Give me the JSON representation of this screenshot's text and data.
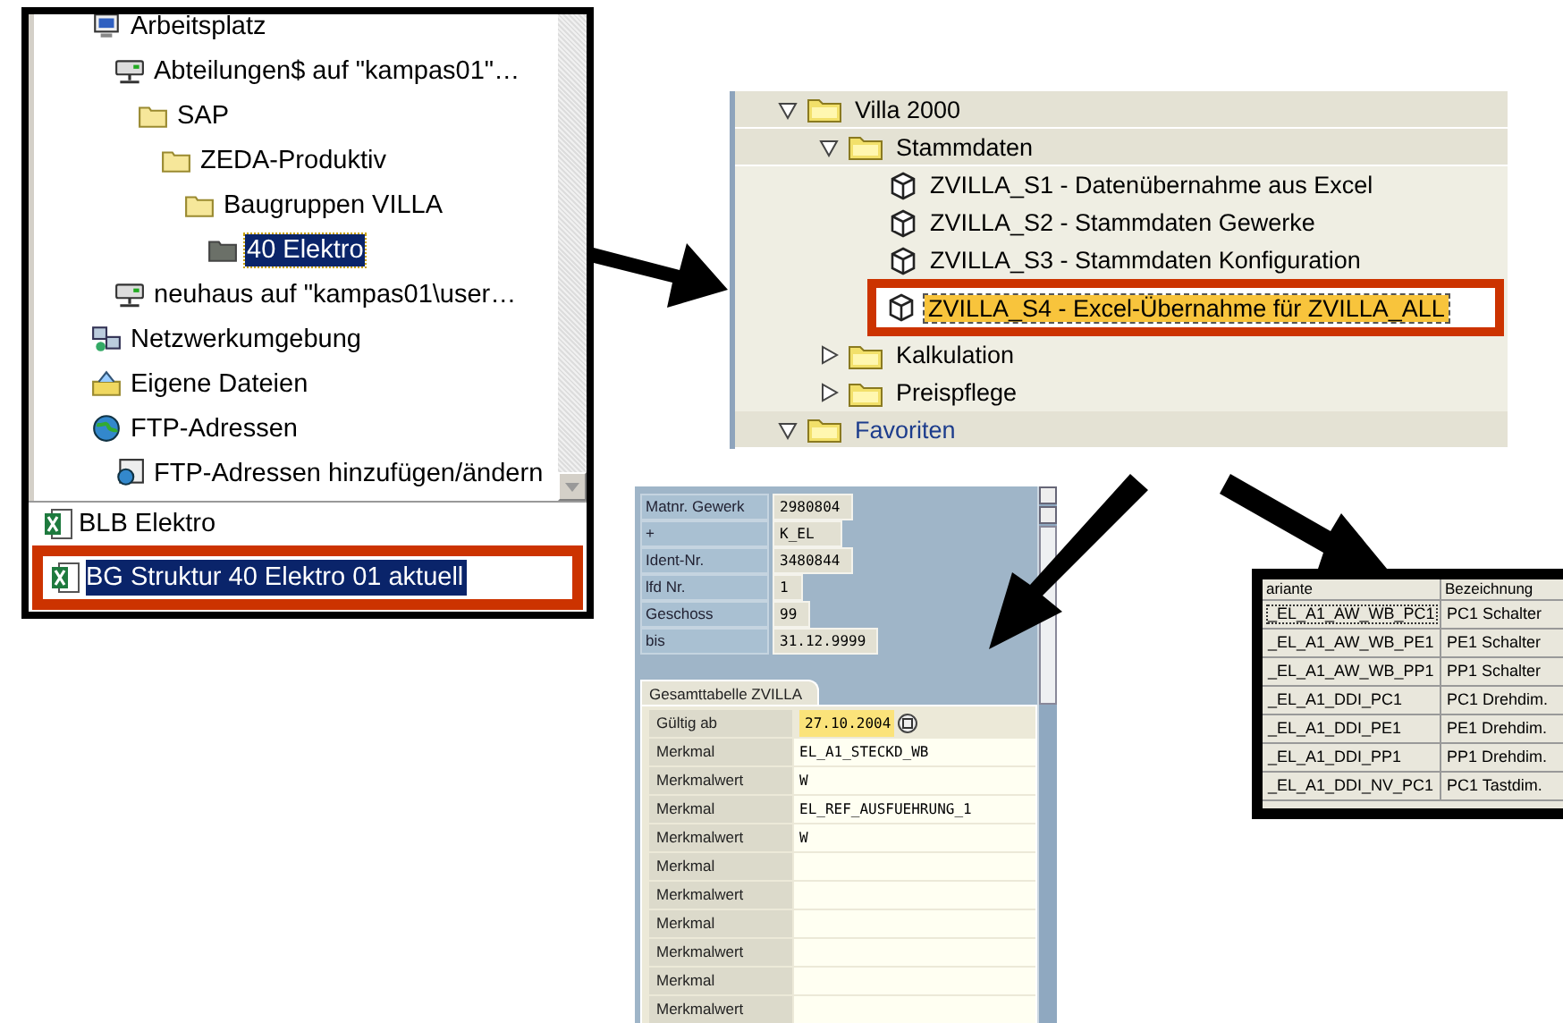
{
  "explorer": {
    "tree": [
      {
        "label": "Arbeitsplatz",
        "kind": "computer",
        "selected": false,
        "children": [
          {
            "label": "Abteilungen$ auf \"kampas01\"…",
            "kind": "drive",
            "selected": false,
            "children": [
              {
                "label": "SAP",
                "kind": "folder",
                "selected": false,
                "children": [
                  {
                    "label": "ZEDA-Produktiv",
                    "kind": "folder",
                    "selected": false,
                    "children": [
                      {
                        "label": "Baugruppen VILLA",
                        "kind": "folder",
                        "selected": false,
                        "children": [
                          {
                            "label": "40 Elektro",
                            "kind": "folder",
                            "selected": true
                          }
                        ]
                      }
                    ]
                  }
                ]
              }
            ]
          },
          {
            "label": "neuhaus auf \"kampas01\\user…",
            "kind": "drive",
            "selected": false
          }
        ]
      },
      {
        "label": "Netzwerkumgebung",
        "kind": "network",
        "selected": false
      },
      {
        "label": "Eigene Dateien",
        "kind": "documents",
        "selected": false
      },
      {
        "label": "FTP-Adressen",
        "kind": "globe",
        "selected": false,
        "children": [
          {
            "label": "FTP-Adressen hinzufügen/ändern",
            "kind": "ftp",
            "selected": false
          }
        ]
      }
    ],
    "files": [
      {
        "name": "BLB Elektro",
        "selected": false
      },
      {
        "name": "BG Struktur 40 Elektro 01 aktuell",
        "selected": true
      }
    ]
  },
  "sap_menu": {
    "items": [
      {
        "label": "Villa 2000",
        "kind": "folder",
        "expanded": true,
        "children": [
          {
            "label": "Stammdaten",
            "kind": "folder",
            "expanded": true,
            "children": [
              {
                "label": "ZVILLA_S1 - Datenübernahme aus Excel",
                "kind": "transaction",
                "selected": false
              },
              {
                "label": "ZVILLA_S2 - Stammdaten Gewerke",
                "kind": "transaction",
                "selected": false
              },
              {
                "label": "ZVILLA_S3 - Stammdaten Konfiguration",
                "kind": "transaction",
                "selected": false
              },
              {
                "label": "ZVILLA_S4 - Excel-Übernahme für ZVILLA_ALL",
                "kind": "transaction",
                "selected": true
              }
            ]
          },
          {
            "label": "Kalkulation",
            "kind": "folder",
            "expanded": false
          },
          {
            "label": "Preispflege",
            "kind": "folder",
            "expanded": false
          }
        ]
      },
      {
        "label": "Favoriten",
        "kind": "folder",
        "expanded": true
      }
    ]
  },
  "form": {
    "fields": [
      {
        "label": "Matnr. Gewerk",
        "value": "2980804"
      },
      {
        "label": "+",
        "value": "K_EL"
      },
      {
        "label": "Ident-Nr.",
        "value": "3480844"
      },
      {
        "label": "lfd Nr.",
        "value": "1"
      },
      {
        "label": "Geschoss",
        "value": "99"
      },
      {
        "label": "bis",
        "value": "31.12.9999"
      }
    ],
    "tab": "Gesamttabelle ZVILLA",
    "rows": [
      {
        "label": "Gültig ab",
        "value": "27.10.2004",
        "kind": "date"
      },
      {
        "label": "Merkmal",
        "value": "EL_A1_STECKD_WB",
        "kind": "text"
      },
      {
        "label": "Merkmalwert",
        "value": "W",
        "kind": "text"
      },
      {
        "label": "Merkmal",
        "value": "EL_REF_AUSFUEHRUNG_1",
        "kind": "text"
      },
      {
        "label": "Merkmalwert",
        "value": "W",
        "kind": "text"
      },
      {
        "label": "Merkmal",
        "kind": "text"
      },
      {
        "label": "Merkmalwert",
        "kind": "text"
      },
      {
        "label": "Merkmal",
        "kind": "text"
      },
      {
        "label": "Merkmalwert",
        "kind": "text"
      },
      {
        "label": "Merkmal",
        "kind": "text"
      },
      {
        "label": "Merkmalwert",
        "kind": "text"
      }
    ]
  },
  "table": {
    "columns": [
      "ariante",
      "Bezeichnung"
    ],
    "rows": [
      [
        "_EL_A1_AW_WB_PC1",
        "PC1 Schalter"
      ],
      [
        "_EL_A1_AW_WB_PE1",
        "PE1 Schalter"
      ],
      [
        "_EL_A1_AW_WB_PP1",
        "PP1 Schalter"
      ],
      [
        "_EL_A1_DDI_PC1",
        "PC1 Drehdim."
      ],
      [
        "_EL_A1_DDI_PE1",
        "PE1 Drehdim."
      ],
      [
        "_EL_A1_DDI_PP1",
        "PP1 Drehdim."
      ],
      [
        "_EL_A1_DDI_NV_PC1",
        "PC1 Tastdim."
      ]
    ]
  }
}
